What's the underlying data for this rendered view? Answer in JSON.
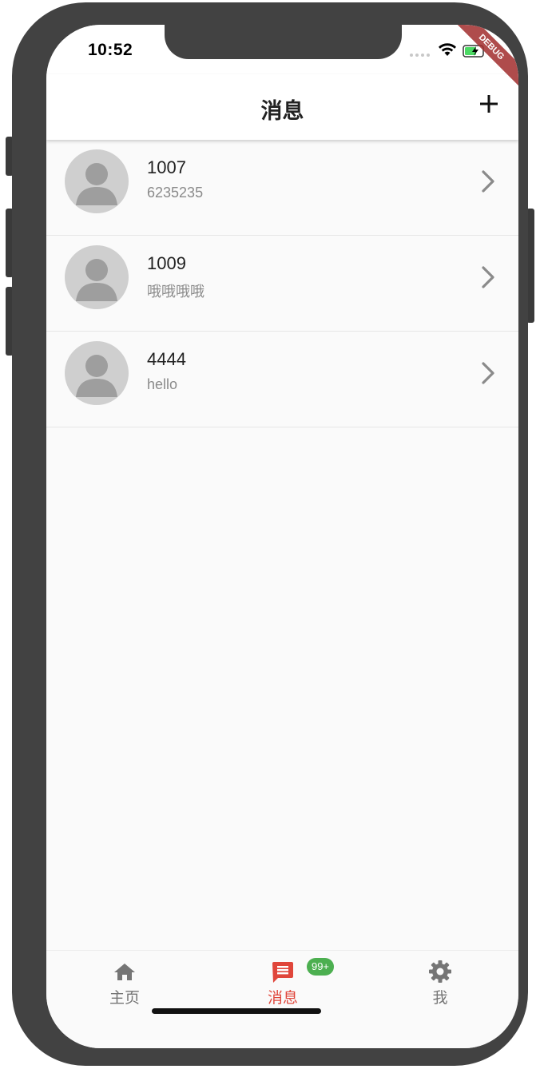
{
  "status_bar": {
    "time": "10:52",
    "debug_label": "DEBUG"
  },
  "app_bar": {
    "title": "消息",
    "add_icon": "plus-icon"
  },
  "messages": [
    {
      "name": "1007",
      "preview": "6235235",
      "avatar_icon": "person-icon"
    },
    {
      "name": "1009",
      "preview": "哦哦哦哦",
      "avatar_icon": "person-icon"
    },
    {
      "name": "4444",
      "preview": "hello",
      "avatar_icon": "person-icon"
    }
  ],
  "bottom_nav": {
    "items": [
      {
        "label": "主页",
        "icon": "home-icon",
        "active": false
      },
      {
        "label": "消息",
        "icon": "message-icon",
        "active": true
      },
      {
        "label": "我",
        "icon": "gear-icon",
        "active": false
      }
    ],
    "badge": "99+"
  },
  "colors": {
    "active": "#e0463b",
    "inactive": "#757575",
    "badge": "#4caf50",
    "frame": "#424242"
  }
}
